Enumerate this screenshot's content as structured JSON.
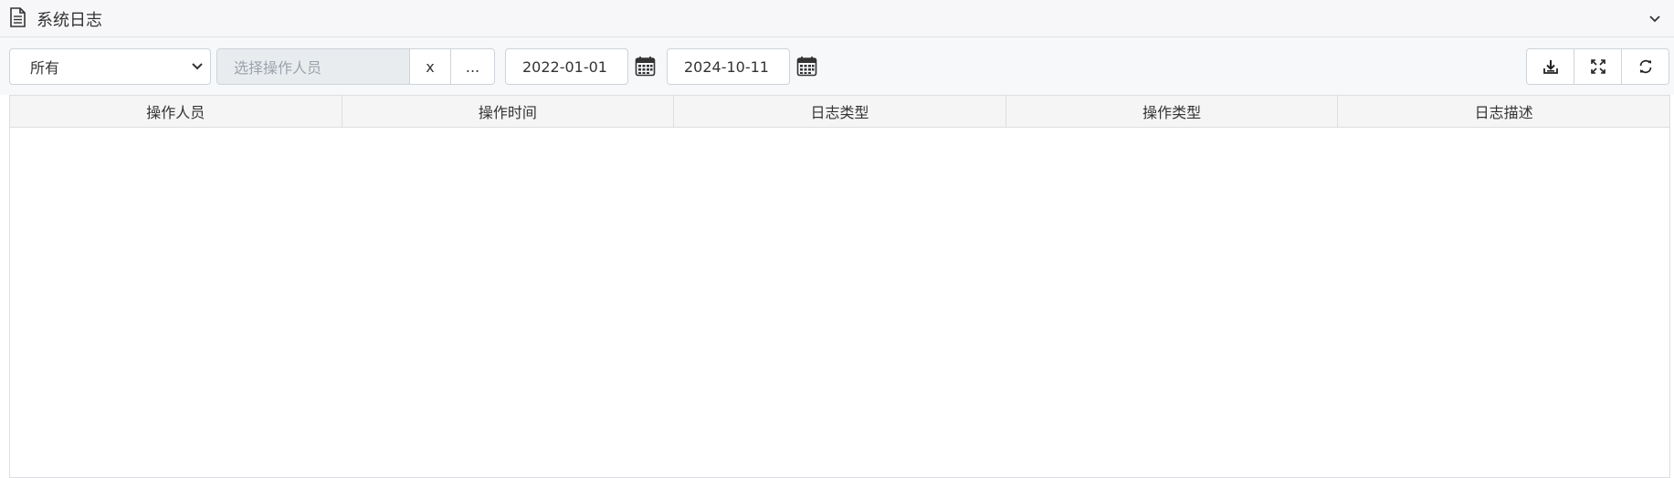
{
  "header": {
    "title": "系统日志",
    "doc_icon": "document-icon",
    "collapse_icon": "chevron-down-icon"
  },
  "toolbar": {
    "log_type_select": {
      "value": "所有"
    },
    "operator": {
      "placeholder": "选择操作人员",
      "value": ""
    },
    "clear_label": "x",
    "more_label": "...",
    "start_date": "2022-01-01",
    "end_date": "2024-10-11",
    "buttons": [
      {
        "icon": "download-icon"
      },
      {
        "icon": "fullscreen-icon"
      },
      {
        "icon": "refresh-icon"
      }
    ]
  },
  "table": {
    "columns": [
      "操作人员",
      "操作时间",
      "日志类型",
      "操作类型",
      "日志描述"
    ],
    "rows": []
  }
}
